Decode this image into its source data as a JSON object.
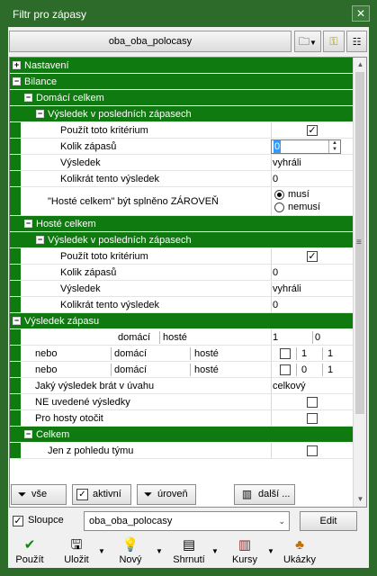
{
  "window": {
    "title": "Filtr pro zápasy",
    "close": "✕"
  },
  "profile": {
    "name": "oba_oba_polocasy"
  },
  "tree": {
    "nastaveni": "Nastavení",
    "bilance": "Bilance",
    "domaci_celkem": "Domácí celkem",
    "vysledek_v_poslednich_1": "Výsledek v posledních zápasech",
    "pouzit_kriterium_1": "Použít toto kritérium",
    "kolik_zapasu_1": "Kolik zápasů",
    "kolik_zapasu_1_val": "0",
    "vysledek_1": "Výsledek",
    "vysledek_1_val": "vyhráli",
    "kolikrat_1": "Kolikrát tento výsledek",
    "kolikrat_1_val": "0",
    "hoste_celkem_label": "\"Hosté celkem\" být splněno ZÁROVEŇ",
    "radio_musi": "musí",
    "radio_nemusi": "nemusí",
    "hoste_celkem": "Hosté celkem",
    "vysledek_v_poslednich_2": "Výsledek v posledních zápasech",
    "pouzit_kriterium_2": "Použít toto kritérium",
    "kolik_zapasu_2": "Kolik zápasů",
    "kolik_zapasu_2_val": "0",
    "vysledek_2": "Výsledek",
    "vysledek_2_val": "vyhráli",
    "kolikrat_2": "Kolikrát tento výsledek",
    "kolikrat_2_val": "0",
    "vysledek_zapasu": "Výsledek zápasu",
    "score_domaci": "domácí",
    "score_hoste": "hosté",
    "score_val_1": "1",
    "score_val_2": "0",
    "nebo": "nebo",
    "domaci": "domácí",
    "hoste": "hosté",
    "nebo1_v1": "1",
    "nebo1_v2": "1",
    "nebo2_v1": "0",
    "nebo2_v2": "1",
    "jaky_vysledek": "Jaký výsledek brát v úvahu",
    "jaky_vysledek_val": "celkový",
    "ne_uvedene": "NE uvedené výsledky",
    "pro_hosty": "Pro hosty otočit",
    "celkem": "Celkem",
    "jen_z_pohledu": "Jen z pohledu týmu"
  },
  "filters": {
    "vse": "vše",
    "aktivni": "aktivní",
    "uroven": "úroveň",
    "dalsi": "další ..."
  },
  "columns": {
    "label": "Sloupce",
    "selected": "oba_oba_polocasy",
    "edit": "Edit"
  },
  "bottom": {
    "pouzit": "Použít",
    "ulozit": "Uložit",
    "novy": "Nový",
    "shrnuti": "Shrnutí",
    "kursy": "Kursy",
    "ukazky": "Ukázky"
  },
  "colors": {
    "window": "#2d6b2b",
    "category": "#0f7a0f"
  }
}
